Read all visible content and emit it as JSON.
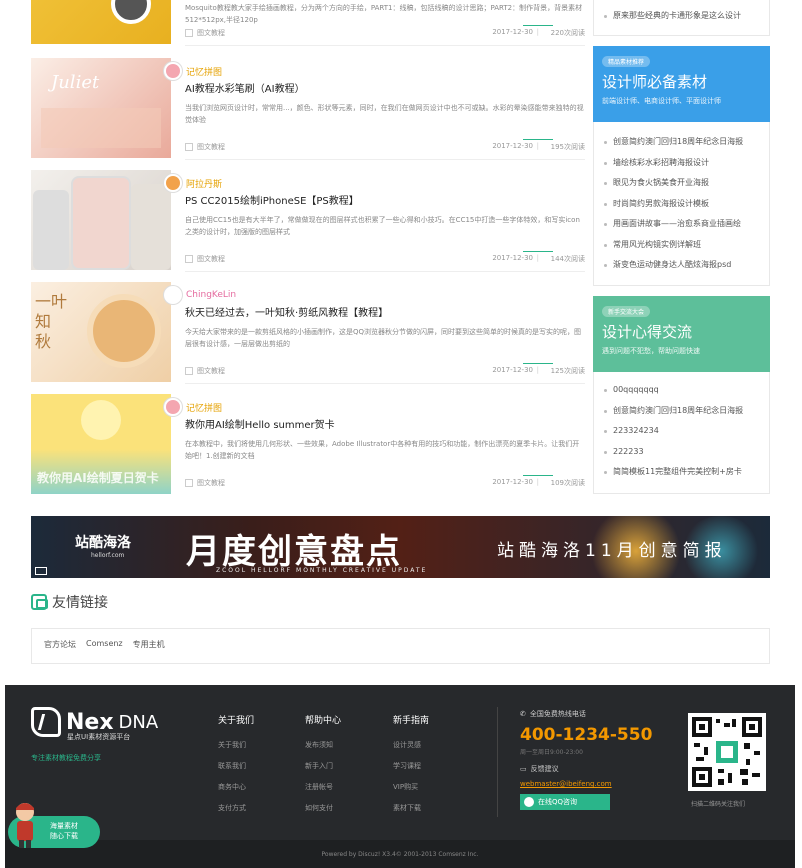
{
  "posts": [
    {
      "author": "",
      "title": "",
      "excerpt": "Mosquito教程教大家手绘插画教程，分为两个方向的手绘，PART1：线稿，包括线稿的设计思路；PART2：制作背景，背景素材512*512px,半径120p",
      "tag": "图文教程",
      "date": "2017-12-30",
      "views": "220次阅读",
      "colors": [
        "#f2c53d",
        "#e8b020"
      ]
    },
    {
      "author": "记忆拼图",
      "title": "AI教程水彩笔刷（AI教程）",
      "excerpt": "当我们浏览网页设计时，常常用...，颜色、形状等元素，同时，在我们在做网页设计中也不可或缺。水彩的晕染感能带来独特的视觉体验",
      "tag": "图文教程",
      "date": "2017-12-30",
      "views": "195次阅读",
      "colors": [
        "#f6d9c9",
        "#e9a99a"
      ]
    },
    {
      "author": "阿拉丹斯",
      "title": "PS CC2015绘制iPhoneSE【PS教程】",
      "excerpt": "自己使用CC15也是有大半年了，常做做现在的图层样式也积累了一些心得和小技巧。在CC15中打造一些字体特效，和写实icon之类的设计时，加强版的图层样式",
      "tag": "图文教程",
      "date": "2017-12-30",
      "views": "144次阅读",
      "colors": [
        "#e6e1dc",
        "#c9c2bc"
      ]
    },
    {
      "author": "ChingKeLin",
      "title": "秋天已经过去，一叶知秋·剪纸风教程【教程】",
      "excerpt": "今天给大家带来的是一款剪纸风格的小插画制作，这是QQ浏览器秋分节做的闪屏，同时要到这些简单的时候真的是写实的呢，图层很有设计感，一层层做出剪纸的",
      "tag": "图文教程",
      "date": "2017-12-30",
      "views": "125次阅读",
      "colors": [
        "#f5e3cf",
        "#e8b784"
      ]
    },
    {
      "author": "记忆拼图",
      "title": "教你用AI绘制Hello summer贺卡",
      "excerpt": "在本教程中，我们将使用几何形状、一些效果，Adobe Illustrator中各种有用的技巧和功能，制作出漂亮的夏季卡片。让我们开始吧！1.创建新的文档",
      "tag": "图文教程",
      "date": "2017-12-30",
      "views": "109次阅读",
      "thumb_text": "教你用AI绘制夏日贺卡",
      "colors": [
        "#fbe27a",
        "#8fd3c7"
      ]
    }
  ],
  "sidebar": {
    "top_item": "原来那些经典的卡通形象是这么设计",
    "block1": {
      "pill": "精品素材推荐",
      "title": "设计师必备素材",
      "subtitle": "前端设计师、电商设计师、平面设计师",
      "items": [
        "创意简约澳门回归18周年纪念日海报",
        "墙绘核彩水彩招聘海报设计",
        "眼见为食火锅美食开业海报",
        "时尚简约男款海报设计模板",
        "用画面讲故事——治愈系商业插画绘",
        "常用风光构镜实例详解班",
        "渐变色运动健身达人酷炫海报psd"
      ],
      "color": "#3a9fe8"
    },
    "block2": {
      "pill": "新手交流大会",
      "title": "设计心得交流",
      "subtitle": "遇到问题不犯愁，帮助问题快速",
      "items": [
        "00qqqqqqq",
        "创意简约澳门回归18周年纪念日海报",
        "223324234",
        "222233",
        "简简模板11完整组件完美控制+房卡"
      ],
      "color": "#5dbf9a"
    }
  },
  "ad": {
    "brand": "站酷海洛",
    "brand_sub": "hellorf.com",
    "headline": "月度创意盘点",
    "subline": "ZCOOL HELLORF MONTHLY CREATIVE UPDATE",
    "right": "站酷海洛11月创意简报"
  },
  "links": {
    "heading": "友情链接",
    "items": [
      "官方论坛",
      "Comsenz",
      "专用主机"
    ]
  },
  "footer": {
    "logo_nex": "Nex",
    "logo_dna": "DNA",
    "logo_sub": "星点UI素材资源平台",
    "slogan": "专注素材教程免费分享",
    "cols": [
      {
        "title": "关于我们",
        "links": [
          "关于我们",
          "联系我们",
          "商务中心",
          "支付方式"
        ]
      },
      {
        "title": "帮助中心",
        "links": [
          "发布须知",
          "新手入门",
          "注册帐号",
          "如何支付"
        ]
      },
      {
        "title": "新手指南",
        "links": [
          "设计灵感",
          "学习课程",
          "VIP购买",
          "素材下载"
        ]
      }
    ],
    "hotline_label": "全国免费热线电话",
    "phone": "400-1234-550",
    "hours": "周一至周日9:00-23:00",
    "feedback": "反馈建议",
    "email": "webmaster@ibeifeng.com",
    "qq": "在线QQ咨询",
    "qr_caption": "扫描二维码关注我们",
    "copyright": "Powered by Discuz! X3.4© 2001-2013 Comsenz Inc."
  },
  "float_promo": {
    "line1": "海量素材",
    "line2": "随心下载"
  }
}
